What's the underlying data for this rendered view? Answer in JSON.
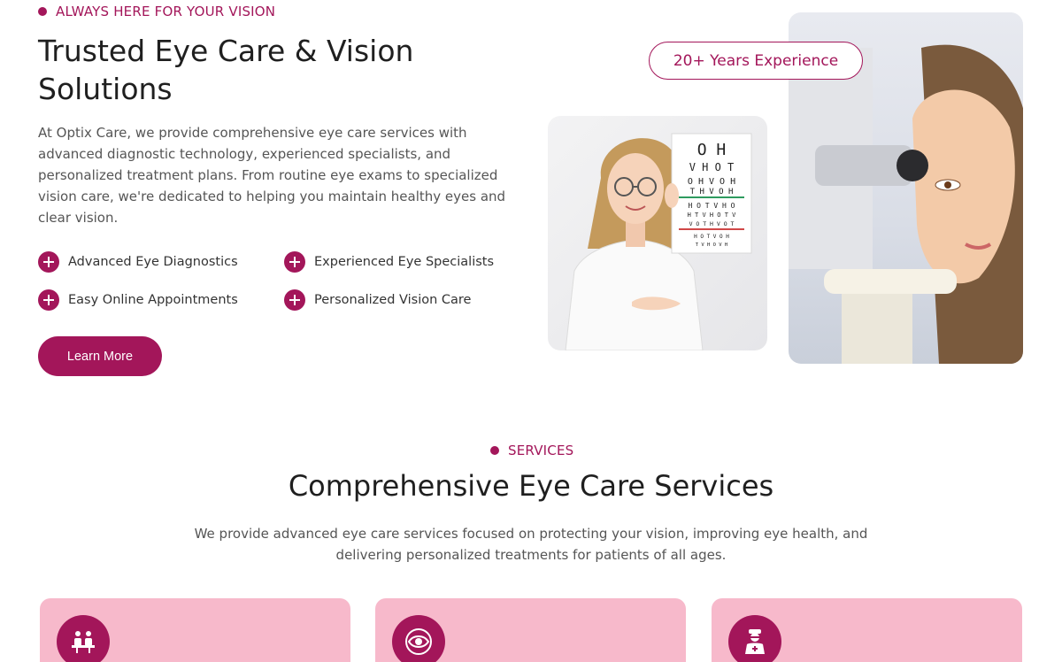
{
  "hero": {
    "eyebrow": "ALWAYS HERE FOR YOUR VISION",
    "title": "Trusted Eye Care & Vision Solutions",
    "description": "At Optix Care, we provide comprehensive eye care services with advanced diagnostic technology, experienced specialists, and personalized treatment plans. From routine eye exams to specialized vision care, we're dedicated to helping you maintain healthy eyes and clear vision.",
    "features": [
      {
        "label": "Advanced Eye Diagnostics",
        "icon": "plus-icon"
      },
      {
        "label": "Experienced Eye Specialists",
        "icon": "plus-icon"
      },
      {
        "label": "Easy Online Appointments",
        "icon": "plus-icon"
      },
      {
        "label": "Personalized Vision Care",
        "icon": "plus-icon"
      }
    ],
    "cta_label": "Learn More",
    "experience_badge": "20+ Years Experience"
  },
  "eye_chart": {
    "rows": [
      "O H",
      "V H O T",
      "O H V O H",
      "T H V O H",
      "H O T V H O",
      "H T V H O T V",
      "V O T H V O T",
      "H O T V O H",
      "T V H O V H"
    ]
  },
  "services": {
    "eyebrow": "SERVICES",
    "title": "Comprehensive Eye Care Services",
    "description": "We provide advanced eye care services focused on protecting your vision, improving eye health, and delivering personalized treatments for patients of all ages.",
    "cards": [
      {
        "icon": "consultation-icon"
      },
      {
        "icon": "eye-icon"
      },
      {
        "icon": "doctor-icon"
      }
    ]
  },
  "colors": {
    "accent": "#a3165a",
    "card_bg": "#f7b9cb",
    "text_dark": "#1f1f1f",
    "text_muted": "#555555"
  }
}
